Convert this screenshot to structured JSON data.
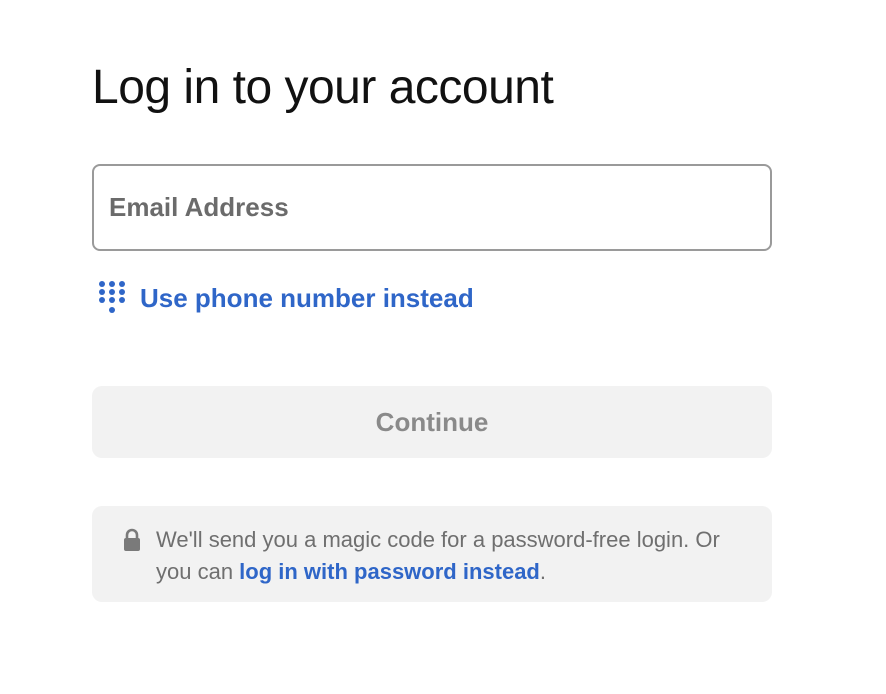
{
  "page": {
    "title": "Log in to your account"
  },
  "email": {
    "placeholder": "Email Address",
    "value": ""
  },
  "phone_link": {
    "label": "Use phone number instead",
    "icon": "keypad-icon"
  },
  "continue_button": {
    "label": "Continue",
    "state": "disabled"
  },
  "info": {
    "icon": "lock-icon",
    "text_before": "We'll send you a magic code for a password-free login. Or you can ",
    "link_label": "log in with password instead",
    "text_after": "."
  },
  "colors": {
    "link": "#2f66c8",
    "button_bg": "#f2f2f2",
    "button_text": "#8a8a8a",
    "info_text": "#6f6f6f",
    "field_border": "#9a9a9a"
  }
}
